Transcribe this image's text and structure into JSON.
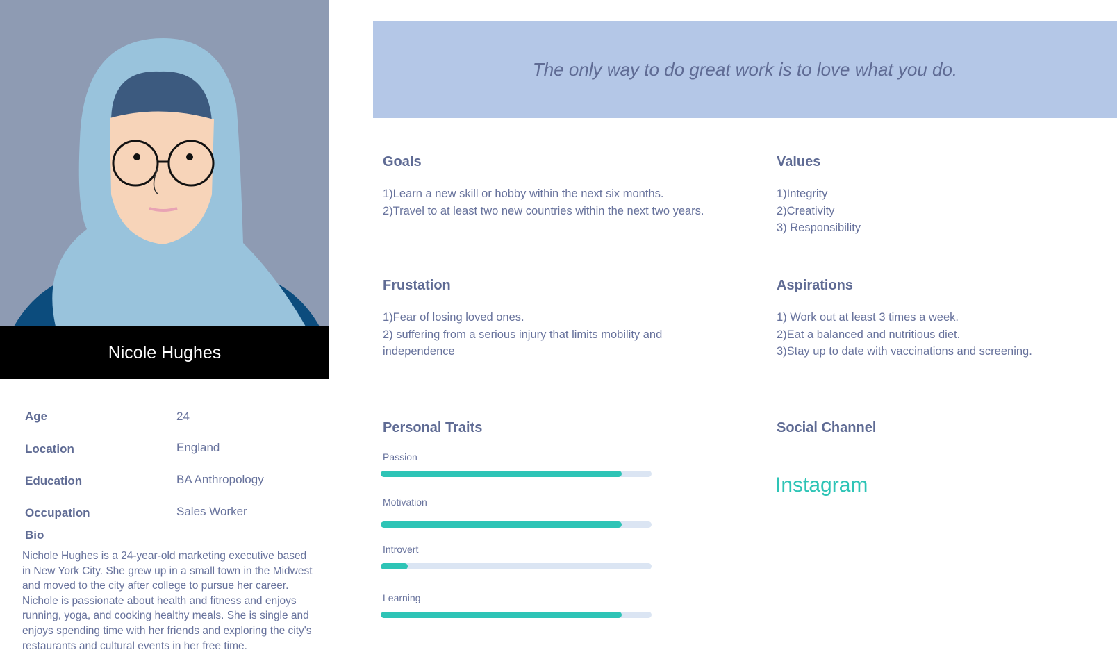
{
  "profile": {
    "name": "Nicole Hughes",
    "fields": [
      {
        "label": "Age",
        "value": "24"
      },
      {
        "label": "Location",
        "value": "England"
      },
      {
        "label": "Education",
        "value": "BA Anthropology"
      },
      {
        "label": "Occupation",
        "value": "Sales Worker"
      }
    ],
    "bio_label": "Bio",
    "bio": "Nichole Hughes is a 24-year-old marketing executive based in New York City. She grew up in a small town in the Midwest and moved to the city after college to pursue her career. Nichole is passionate about health and fitness and enjoys running, yoga, and cooking healthy meals. She is single and enjoys spending time with her friends and exploring the city's restaurants and cultural events in her free time."
  },
  "quote": "The only way to do great work is to love what you do.",
  "goals": {
    "title": "Goals",
    "lines": [
      "1)Learn a new skill or hobby within the next six months.",
      "2)Travel to at least two new countries within the next two years."
    ]
  },
  "values": {
    "title": "Values",
    "lines": [
      "1)Integrity",
      "2)Creativity",
      "3) Responsibility"
    ]
  },
  "frustration": {
    "title": "Frustation",
    "lines": [
      "1)Fear of losing loved ones.",
      "2) suffering from a serious injury that limits mobility and independence"
    ]
  },
  "aspirations": {
    "title": "Aspirations",
    "lines": [
      "1) Work out at least 3 times a week.",
      "2)Eat a balanced and nutritious diet.",
      "3)Stay up to date with vaccinations and screening."
    ]
  },
  "traits": {
    "title": "Personal Traits",
    "items": [
      {
        "label": "Passion",
        "value": 0.89
      },
      {
        "label": "Motivation",
        "value": 0.89
      },
      {
        "label": "Introvert",
        "value": 0.1
      },
      {
        "label": "Learning",
        "value": 0.89
      }
    ]
  },
  "social": {
    "title": "Social Channel",
    "channel": "Instagram"
  },
  "colors": {
    "accent": "#2ec4b6",
    "quote_bg": "#b4c7e7",
    "text": "#67729c"
  }
}
